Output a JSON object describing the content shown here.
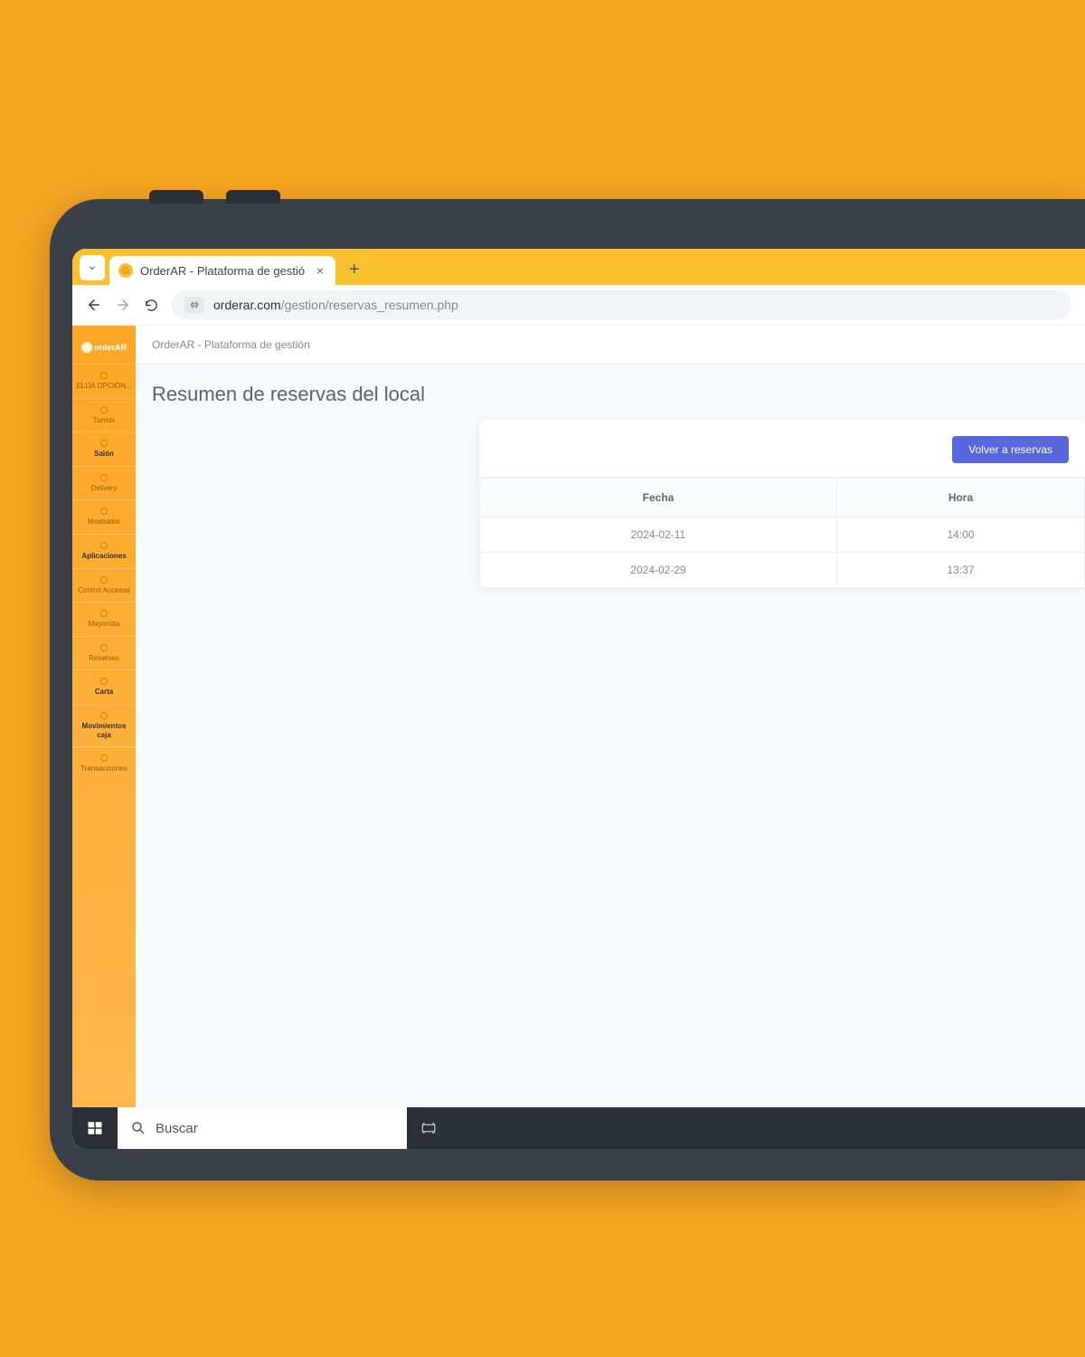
{
  "browser": {
    "tab_title": "OrderAR - Plataforma de gestió",
    "url_domain": "orderar.com",
    "url_path": "/gestion/reservas_resumen.php"
  },
  "sidebar": {
    "logo": "orderAR",
    "items": [
      {
        "label": "ELIJA OPCIÓN...",
        "bold": false
      },
      {
        "label": "Turnos",
        "bold": false
      },
      {
        "label": "Salón",
        "bold": true
      },
      {
        "label": "Delivery",
        "bold": false
      },
      {
        "label": "Mostrador",
        "bold": false
      },
      {
        "label": "Aplicaciones",
        "bold": true
      },
      {
        "label": "Control Accesos",
        "bold": false
      },
      {
        "label": "Mayorista",
        "bold": false
      },
      {
        "label": "Reservas",
        "bold": false
      },
      {
        "label": "Carta",
        "bold": true
      },
      {
        "label": "Movimientos caja",
        "bold": true
      },
      {
        "label": "Transacciones",
        "bold": false
      }
    ]
  },
  "page": {
    "breadcrumb": "OrderAR - Plataforma de gestión",
    "title": "Resumen de reservas del local",
    "back_button": "Volver a reservas",
    "table": {
      "columns": [
        "Fecha",
        "Hora"
      ],
      "rows": [
        {
          "fecha": "2024-02-11",
          "hora": "14:00"
        },
        {
          "fecha": "2024-02-29",
          "hora": "13:37"
        }
      ]
    }
  },
  "taskbar": {
    "search_placeholder": "Buscar"
  }
}
